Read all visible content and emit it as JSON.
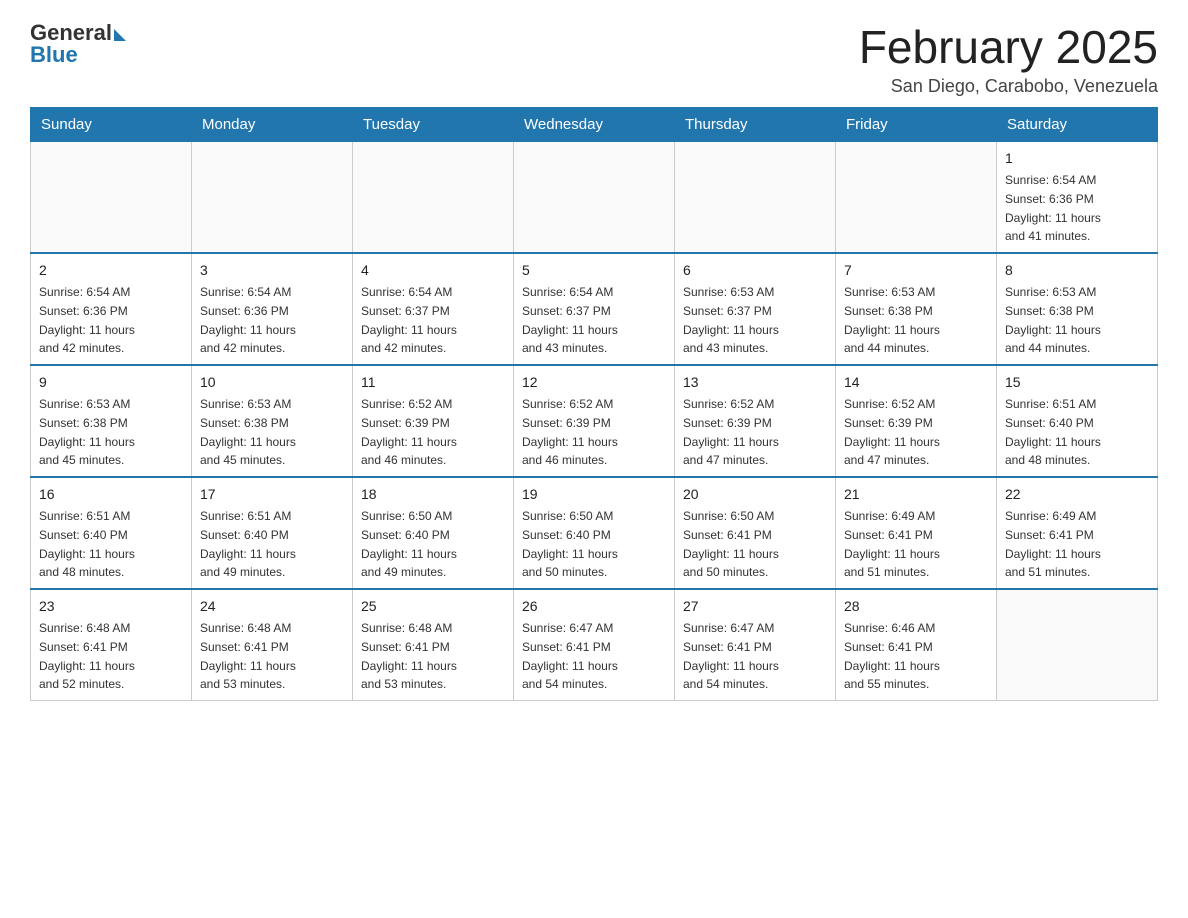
{
  "header": {
    "logo_general": "General",
    "logo_blue": "Blue",
    "month_title": "February 2025",
    "location": "San Diego, Carabobo, Venezuela"
  },
  "weekdays": [
    "Sunday",
    "Monday",
    "Tuesday",
    "Wednesday",
    "Thursday",
    "Friday",
    "Saturday"
  ],
  "weeks": [
    [
      {
        "day": "",
        "info": ""
      },
      {
        "day": "",
        "info": ""
      },
      {
        "day": "",
        "info": ""
      },
      {
        "day": "",
        "info": ""
      },
      {
        "day": "",
        "info": ""
      },
      {
        "day": "",
        "info": ""
      },
      {
        "day": "1",
        "info": "Sunrise: 6:54 AM\nSunset: 6:36 PM\nDaylight: 11 hours\nand 41 minutes."
      }
    ],
    [
      {
        "day": "2",
        "info": "Sunrise: 6:54 AM\nSunset: 6:36 PM\nDaylight: 11 hours\nand 42 minutes."
      },
      {
        "day": "3",
        "info": "Sunrise: 6:54 AM\nSunset: 6:36 PM\nDaylight: 11 hours\nand 42 minutes."
      },
      {
        "day": "4",
        "info": "Sunrise: 6:54 AM\nSunset: 6:37 PM\nDaylight: 11 hours\nand 42 minutes."
      },
      {
        "day": "5",
        "info": "Sunrise: 6:54 AM\nSunset: 6:37 PM\nDaylight: 11 hours\nand 43 minutes."
      },
      {
        "day": "6",
        "info": "Sunrise: 6:53 AM\nSunset: 6:37 PM\nDaylight: 11 hours\nand 43 minutes."
      },
      {
        "day": "7",
        "info": "Sunrise: 6:53 AM\nSunset: 6:38 PM\nDaylight: 11 hours\nand 44 minutes."
      },
      {
        "day": "8",
        "info": "Sunrise: 6:53 AM\nSunset: 6:38 PM\nDaylight: 11 hours\nand 44 minutes."
      }
    ],
    [
      {
        "day": "9",
        "info": "Sunrise: 6:53 AM\nSunset: 6:38 PM\nDaylight: 11 hours\nand 45 minutes."
      },
      {
        "day": "10",
        "info": "Sunrise: 6:53 AM\nSunset: 6:38 PM\nDaylight: 11 hours\nand 45 minutes."
      },
      {
        "day": "11",
        "info": "Sunrise: 6:52 AM\nSunset: 6:39 PM\nDaylight: 11 hours\nand 46 minutes."
      },
      {
        "day": "12",
        "info": "Sunrise: 6:52 AM\nSunset: 6:39 PM\nDaylight: 11 hours\nand 46 minutes."
      },
      {
        "day": "13",
        "info": "Sunrise: 6:52 AM\nSunset: 6:39 PM\nDaylight: 11 hours\nand 47 minutes."
      },
      {
        "day": "14",
        "info": "Sunrise: 6:52 AM\nSunset: 6:39 PM\nDaylight: 11 hours\nand 47 minutes."
      },
      {
        "day": "15",
        "info": "Sunrise: 6:51 AM\nSunset: 6:40 PM\nDaylight: 11 hours\nand 48 minutes."
      }
    ],
    [
      {
        "day": "16",
        "info": "Sunrise: 6:51 AM\nSunset: 6:40 PM\nDaylight: 11 hours\nand 48 minutes."
      },
      {
        "day": "17",
        "info": "Sunrise: 6:51 AM\nSunset: 6:40 PM\nDaylight: 11 hours\nand 49 minutes."
      },
      {
        "day": "18",
        "info": "Sunrise: 6:50 AM\nSunset: 6:40 PM\nDaylight: 11 hours\nand 49 minutes."
      },
      {
        "day": "19",
        "info": "Sunrise: 6:50 AM\nSunset: 6:40 PM\nDaylight: 11 hours\nand 50 minutes."
      },
      {
        "day": "20",
        "info": "Sunrise: 6:50 AM\nSunset: 6:41 PM\nDaylight: 11 hours\nand 50 minutes."
      },
      {
        "day": "21",
        "info": "Sunrise: 6:49 AM\nSunset: 6:41 PM\nDaylight: 11 hours\nand 51 minutes."
      },
      {
        "day": "22",
        "info": "Sunrise: 6:49 AM\nSunset: 6:41 PM\nDaylight: 11 hours\nand 51 minutes."
      }
    ],
    [
      {
        "day": "23",
        "info": "Sunrise: 6:48 AM\nSunset: 6:41 PM\nDaylight: 11 hours\nand 52 minutes."
      },
      {
        "day": "24",
        "info": "Sunrise: 6:48 AM\nSunset: 6:41 PM\nDaylight: 11 hours\nand 53 minutes."
      },
      {
        "day": "25",
        "info": "Sunrise: 6:48 AM\nSunset: 6:41 PM\nDaylight: 11 hours\nand 53 minutes."
      },
      {
        "day": "26",
        "info": "Sunrise: 6:47 AM\nSunset: 6:41 PM\nDaylight: 11 hours\nand 54 minutes."
      },
      {
        "day": "27",
        "info": "Sunrise: 6:47 AM\nSunset: 6:41 PM\nDaylight: 11 hours\nand 54 minutes."
      },
      {
        "day": "28",
        "info": "Sunrise: 6:46 AM\nSunset: 6:41 PM\nDaylight: 11 hours\nand 55 minutes."
      },
      {
        "day": "",
        "info": ""
      }
    ]
  ]
}
